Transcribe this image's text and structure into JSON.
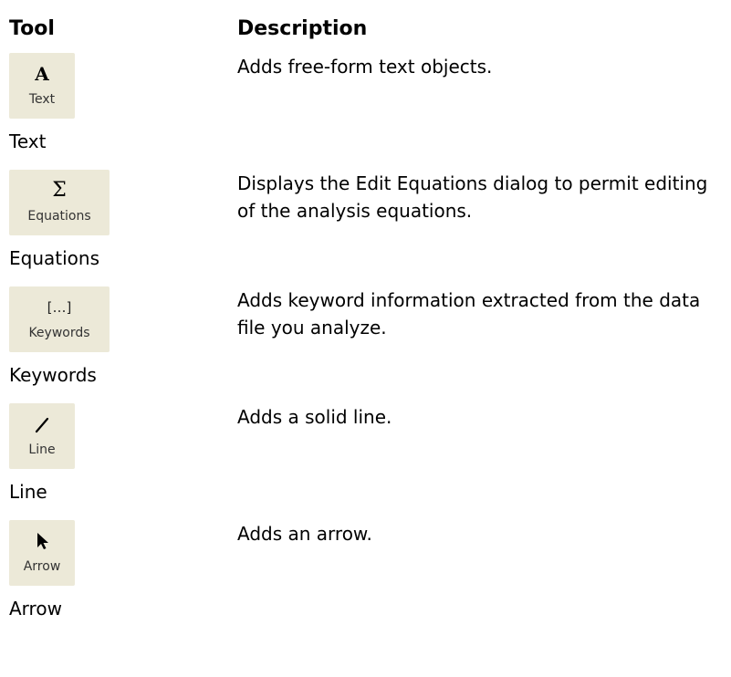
{
  "header": {
    "tool": "Tool",
    "description": "Description"
  },
  "tools": [
    {
      "button_label": "Text",
      "name": "Text",
      "description": "Adds free-form text objects.",
      "icon": "text-icon",
      "icon_glyph": "A"
    },
    {
      "button_label": "Equations",
      "name": "Equations",
      "description": "Displays the Edit Equations dialog to permit editing of the analysis equations.",
      "icon": "sigma-icon",
      "icon_glyph": "Σ"
    },
    {
      "button_label": "Keywords",
      "name": "Keywords",
      "description": "Adds keyword information extracted from the data file you analyze.",
      "icon": "keywords-icon",
      "icon_glyph": "[…]"
    },
    {
      "button_label": "Line",
      "name": "Line",
      "description": "Adds a solid line.",
      "icon": "line-icon"
    },
    {
      "button_label": "Arrow",
      "name": "Arrow",
      "description": "Adds an arrow.",
      "icon": "arrow-pointer-icon"
    }
  ],
  "colors": {
    "button_face": "#ece9d8",
    "text": "#000000"
  }
}
